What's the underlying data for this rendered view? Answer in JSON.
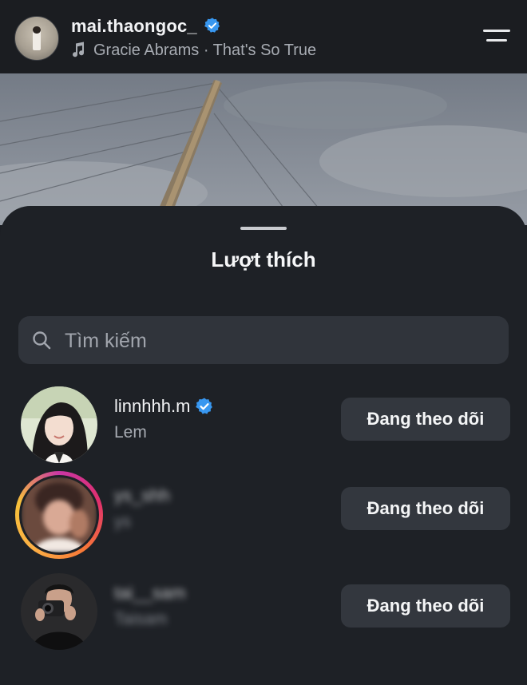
{
  "post_header": {
    "username": "mai.thaongoc_",
    "music_text": "Gracie Abrams · That's So True"
  },
  "likes_sheet": {
    "title": "Lượt thích",
    "search_placeholder": "Tìm kiếm",
    "users": [
      {
        "username": "linnhhh.m",
        "subname": "Lem",
        "button_label": "Đang theo dõi",
        "verified": true,
        "blurred": false
      },
      {
        "username": "ys_shh",
        "subname": "ys",
        "button_label": "Đang theo dõi",
        "verified": false,
        "blurred": true,
        "has_story_ring": true
      },
      {
        "username": "tai__sam",
        "subname": "Taisam",
        "button_label": "Đang theo dõi",
        "verified": false,
        "blurred": true
      }
    ]
  },
  "colors": {
    "background": "#1e2126",
    "verified_badge": "#3897f0",
    "button_bg": "#33373e",
    "search_bg": "#30343b"
  },
  "icons": [
    "verified-badge-icon",
    "music-note-icon",
    "menu-icon",
    "search-icon"
  ]
}
